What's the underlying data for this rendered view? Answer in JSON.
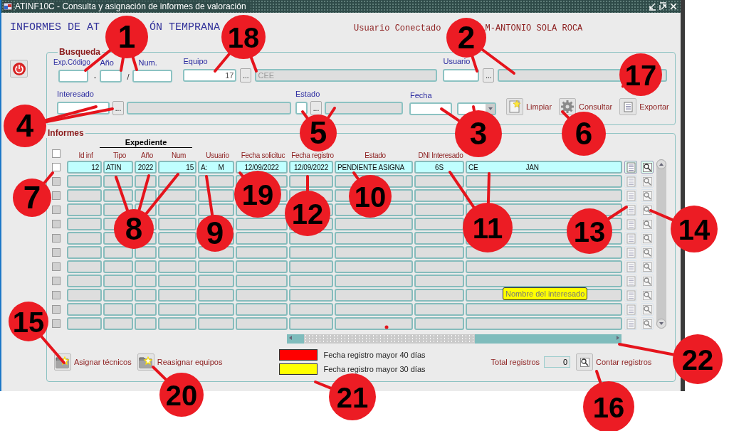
{
  "window": {
    "title": "ATINF10C - Consulta y asignación de informes de valoración"
  },
  "header": {
    "title_parts": [
      "INFORMES DE AT",
      "ÓN TEMPRANA"
    ],
    "user_label": "Usuario Conectado",
    "user_name": "M-ANTONIO SOLA ROCA"
  },
  "search": {
    "legend": "Busqueda",
    "exp_label": "Exp.Código",
    "code_separator": "-",
    "year_label": "Año",
    "year_separator": "/",
    "num_label": "Num.",
    "equipo": {
      "label": "Equipo",
      "value": "17",
      "lookup": "...",
      "description": "CEE"
    },
    "usuario": {
      "label": "Usuario",
      "lookup": "..."
    },
    "interesado": {
      "label": "Interesado",
      "lookup": "..."
    },
    "estado": {
      "label": "Estado",
      "lookup": "..."
    },
    "fecha": {
      "label": "Fecha"
    },
    "buttons": [
      {
        "kind": "clear",
        "label": "Limpiar"
      },
      {
        "kind": "query",
        "label": "Consultar"
      },
      {
        "kind": "export",
        "label": "Exportar"
      }
    ]
  },
  "informes": {
    "legend": "Informes",
    "group_header": "Expediente",
    "all_checked": false,
    "columns": [
      "Id inf",
      "Tipo",
      "Año",
      "Num",
      "Usuario",
      "Fecha solicituc",
      "Fecha registro",
      "Estado",
      "DNI Interesado"
    ],
    "rows": [
      {
        "selected": true,
        "checked": false,
        "cells": [
          "12",
          "ATIN",
          "2022",
          "15",
          "A:      M",
          "12/09/2022",
          "12/09/2022",
          "PENDIENTE ASIGNA",
          "6S",
          "CE                          JAN"
        ]
      },
      {
        "selected": false,
        "checked": false
      },
      {
        "selected": false,
        "checked": false
      },
      {
        "selected": false,
        "checked": false
      },
      {
        "selected": false,
        "checked": false
      },
      {
        "selected": false,
        "checked": false
      },
      {
        "selected": false,
        "checked": false
      },
      {
        "selected": false,
        "checked": false
      },
      {
        "selected": false,
        "checked": false
      },
      {
        "selected": false,
        "checked": false
      },
      {
        "selected": false,
        "checked": false
      },
      {
        "selected": false,
        "checked": false
      }
    ],
    "tooltip": "Nombre del interesado"
  },
  "footer": {
    "buttons": [
      {
        "label": "Asignar técnicos"
      },
      {
        "label": "Reasignar equipos"
      }
    ],
    "legend": [
      {
        "color": "#ff0000",
        "label": "Fecha registro mayor 40 días"
      },
      {
        "color": "#ffff00",
        "label": "Fecha registro mayor 30 días"
      }
    ],
    "total_label": "Total registros",
    "total_value": "0",
    "count_button": "Contar registros"
  },
  "annotations": [
    "1",
    "18",
    "2",
    "17",
    "4",
    "5",
    "3",
    "6",
    "7",
    "8",
    "9",
    "19",
    "12",
    "10",
    "11",
    "13",
    "14",
    "15",
    "20",
    "21",
    "16",
    "22"
  ]
}
